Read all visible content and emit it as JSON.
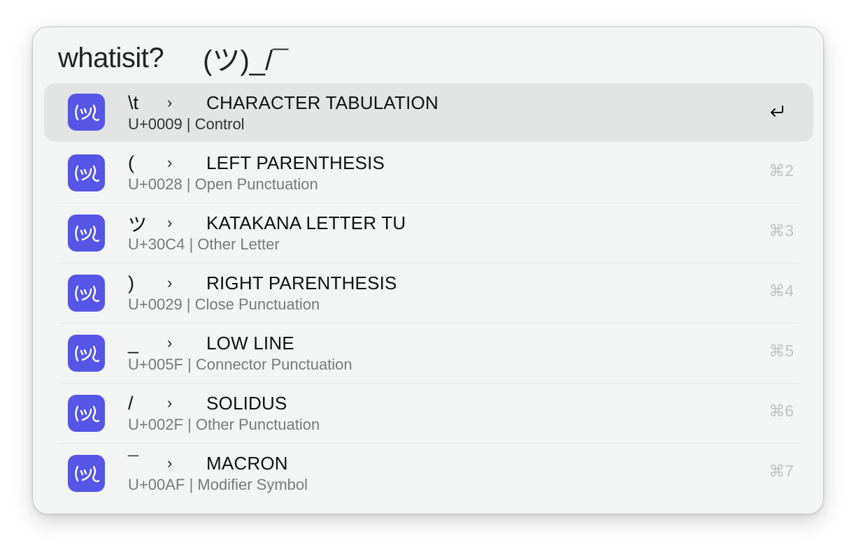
{
  "search": {
    "keyword": "whatisit?",
    "argument": "(ツ)_/¯"
  },
  "results": [
    {
      "char": "\\t",
      "name": "CHARACTER TABULATION",
      "code": "U+0009",
      "category": "Control",
      "shortcut": "",
      "selected": true
    },
    {
      "char": "(",
      "name": "LEFT PARENTHESIS",
      "code": "U+0028",
      "category": "Open Punctuation",
      "shortcut": "⌘2"
    },
    {
      "char": "ツ",
      "name": "KATAKANA LETTER TU",
      "code": "U+30C4",
      "category": "Other Letter",
      "shortcut": "⌘3"
    },
    {
      "char": ")",
      "name": "RIGHT PARENTHESIS",
      "code": "U+0029",
      "category": "Close Punctuation",
      "shortcut": "⌘4"
    },
    {
      "char": "_",
      "name": "LOW LINE",
      "code": "U+005F",
      "category": "Connector Punctuation",
      "shortcut": "⌘5"
    },
    {
      "char": "/",
      "name": "SOLIDUS",
      "code": "U+002F",
      "category": "Other Punctuation",
      "shortcut": "⌘6"
    },
    {
      "char": "¯",
      "name": "MACRON",
      "code": "U+00AF",
      "category": "Modifier Symbol",
      "shortcut": "⌘7"
    }
  ],
  "separator": "›",
  "subtitle_sep": " | ",
  "icon": "whatisit-app-icon",
  "enter_icon": "return-icon",
  "colors": {
    "accent": "#5555e6",
    "selected_row": "#e3e4e4",
    "window_bg": "#f3f4f4",
    "shortcut_text": "#c3c3c3"
  }
}
